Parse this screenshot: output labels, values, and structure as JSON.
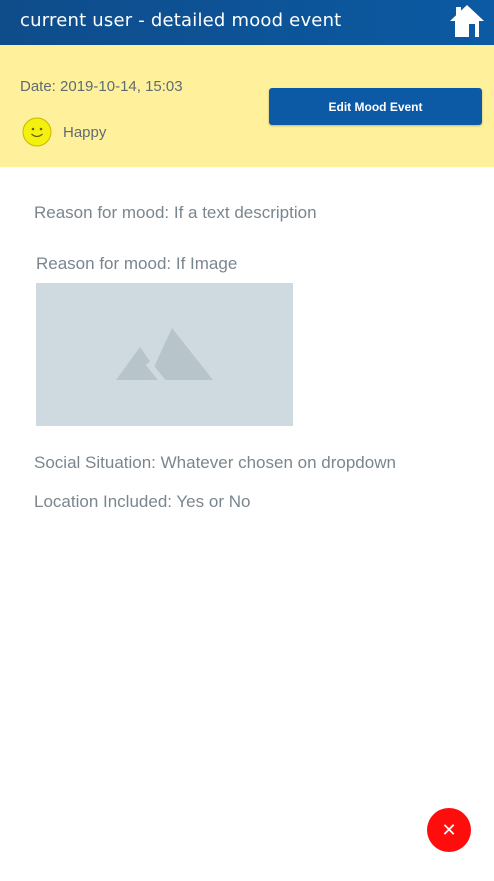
{
  "header": {
    "title": "current user - detailed mood event",
    "home_icon": "home-icon"
  },
  "summary": {
    "date_text": "Date: 2019-10-14, 15:03",
    "mood_label": "Happy",
    "mood_icon": "smiley-face-icon",
    "edit_button_label": "Edit Mood Event",
    "background_color": "#fff19b",
    "button_color": "#0c5aa6"
  },
  "details": {
    "reason_text": "Reason for mood: If a text description",
    "reason_image_label": "Reason for mood: If Image",
    "image_icon": "image-placeholder-icon",
    "social_situation": "Social Situation: Whatever chosen on dropdown",
    "location_included": "Location Included: Yes or No"
  },
  "fab": {
    "icon": "close-icon",
    "glyph": "✕",
    "color": "#ff0c0c"
  }
}
